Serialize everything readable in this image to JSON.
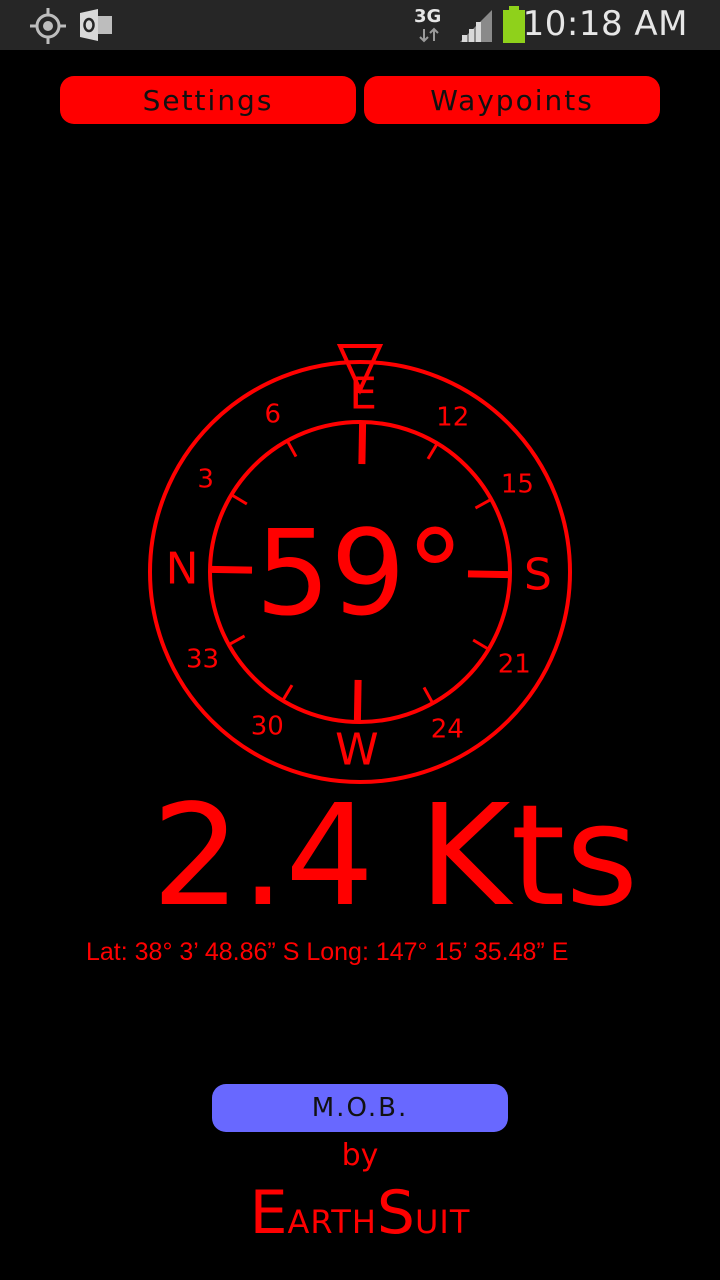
{
  "status_bar": {
    "time": "10:18 AM",
    "network_type": "3G",
    "icons": [
      "gps-icon",
      "outlook-icon",
      "data-transfer-icon",
      "signal-icon",
      "battery-icon"
    ]
  },
  "buttons": {
    "settings_label": "Settings",
    "waypoints_label": "Waypoints",
    "mob_label": "M.O.B."
  },
  "compass": {
    "heading_deg": 59,
    "heading_display": "59°",
    "cardinals": [
      "N",
      "E",
      "S",
      "W"
    ],
    "tick_labels": [
      "3",
      "6",
      "12",
      "15",
      "21",
      "24",
      "30",
      "33"
    ]
  },
  "speed": {
    "display": "2.4 Kts"
  },
  "position": {
    "display": "Lat: 38° 3’ 48.86” S  Long: 147° 15’ 35.48” E"
  },
  "credit": {
    "by": "by",
    "brand_parts": [
      {
        "text": "E",
        "cap": true
      },
      {
        "text": "ARTH",
        "cap": false
      },
      {
        "text": "S",
        "cap": true
      },
      {
        "text": "UIT",
        "cap": false
      }
    ],
    "brand": "EarthSuit"
  },
  "colors": {
    "background": "#000000",
    "accent": "#ff0000",
    "mob_button": "#6868ff",
    "status_bar": "#262626"
  }
}
